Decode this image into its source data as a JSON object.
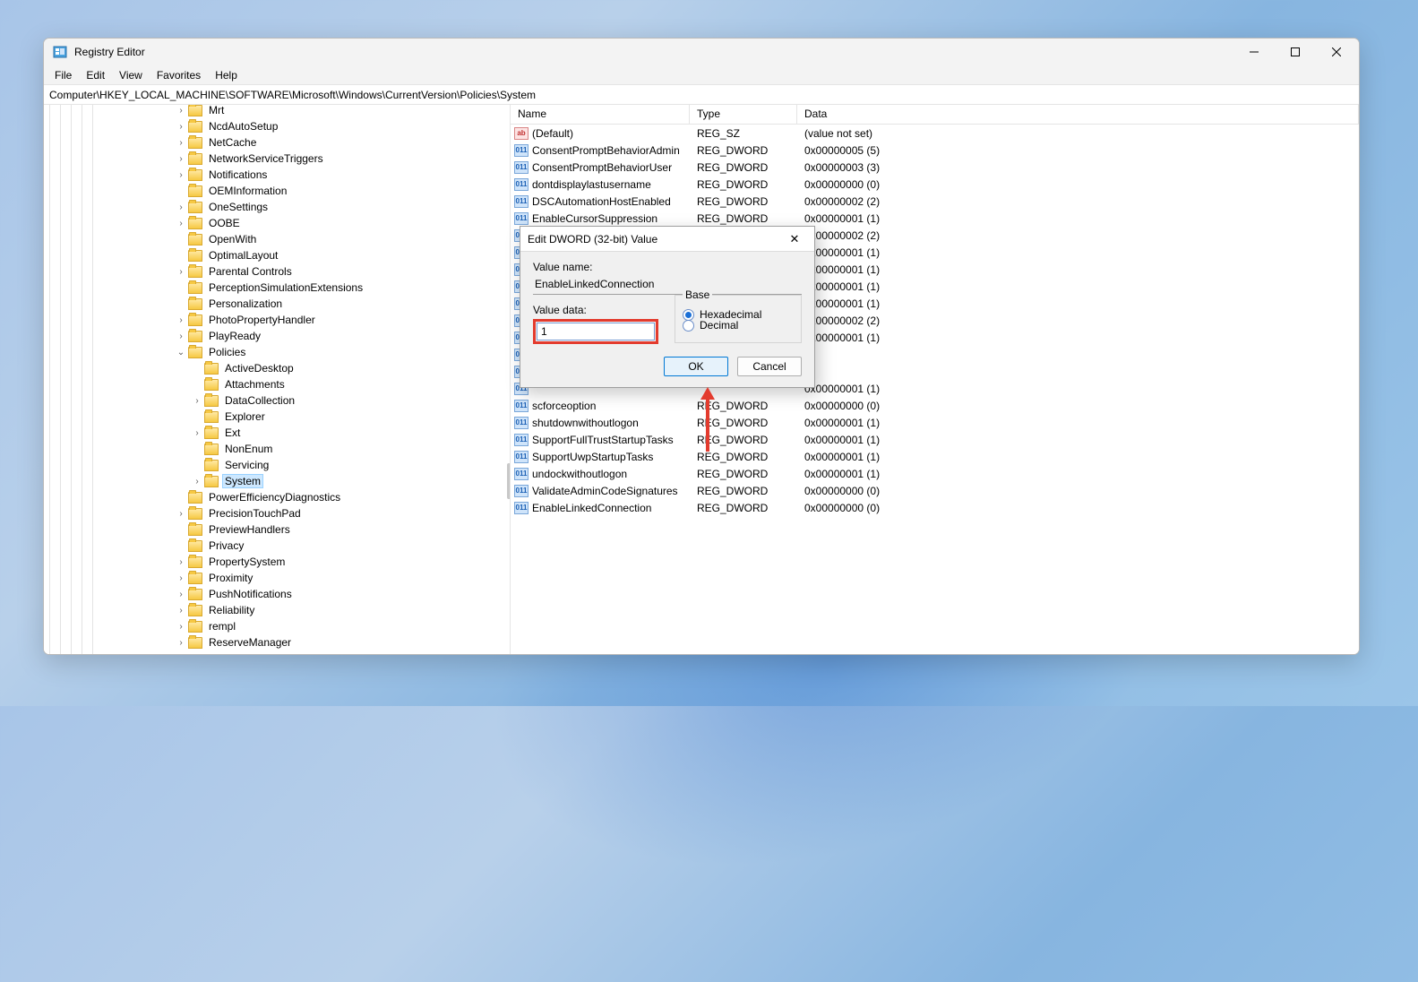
{
  "window": {
    "title": "Registry Editor",
    "menus": [
      "File",
      "Edit",
      "View",
      "Favorites",
      "Help"
    ],
    "address": "Computer\\HKEY_LOCAL_MACHINE\\SOFTWARE\\Microsoft\\Windows\\CurrentVersion\\Policies\\System"
  },
  "tree": [
    {
      "indent": 5,
      "expand": ">",
      "label": "Mrt"
    },
    {
      "indent": 5,
      "expand": ">",
      "label": "NcdAutoSetup"
    },
    {
      "indent": 5,
      "expand": ">",
      "label": "NetCache"
    },
    {
      "indent": 5,
      "expand": ">",
      "label": "NetworkServiceTriggers"
    },
    {
      "indent": 5,
      "expand": ">",
      "label": "Notifications"
    },
    {
      "indent": 5,
      "expand": "",
      "label": "OEMInformation"
    },
    {
      "indent": 5,
      "expand": ">",
      "label": "OneSettings"
    },
    {
      "indent": 5,
      "expand": ">",
      "label": "OOBE"
    },
    {
      "indent": 5,
      "expand": "",
      "label": "OpenWith"
    },
    {
      "indent": 5,
      "expand": "",
      "label": "OptimalLayout"
    },
    {
      "indent": 5,
      "expand": ">",
      "label": "Parental Controls"
    },
    {
      "indent": 5,
      "expand": "",
      "label": "PerceptionSimulationExtensions"
    },
    {
      "indent": 5,
      "expand": "",
      "label": "Personalization"
    },
    {
      "indent": 5,
      "expand": ">",
      "label": "PhotoPropertyHandler"
    },
    {
      "indent": 5,
      "expand": ">",
      "label": "PlayReady"
    },
    {
      "indent": 5,
      "expand": "v",
      "label": "Policies"
    },
    {
      "indent": 6,
      "expand": "",
      "label": "ActiveDesktop"
    },
    {
      "indent": 6,
      "expand": "",
      "label": "Attachments"
    },
    {
      "indent": 6,
      "expand": ">",
      "label": "DataCollection"
    },
    {
      "indent": 6,
      "expand": "",
      "label": "Explorer"
    },
    {
      "indent": 6,
      "expand": ">",
      "label": "Ext"
    },
    {
      "indent": 6,
      "expand": "",
      "label": "NonEnum"
    },
    {
      "indent": 6,
      "expand": "",
      "label": "Servicing"
    },
    {
      "indent": 6,
      "expand": ">",
      "label": "System",
      "selected": true
    },
    {
      "indent": 5,
      "expand": "",
      "label": "PowerEfficiencyDiagnostics"
    },
    {
      "indent": 5,
      "expand": ">",
      "label": "PrecisionTouchPad"
    },
    {
      "indent": 5,
      "expand": "",
      "label": "PreviewHandlers"
    },
    {
      "indent": 5,
      "expand": "",
      "label": "Privacy"
    },
    {
      "indent": 5,
      "expand": ">",
      "label": "PropertySystem"
    },
    {
      "indent": 5,
      "expand": ">",
      "label": "Proximity"
    },
    {
      "indent": 5,
      "expand": ">",
      "label": "PushNotifications"
    },
    {
      "indent": 5,
      "expand": ">",
      "label": "Reliability"
    },
    {
      "indent": 5,
      "expand": ">",
      "label": "rempl"
    },
    {
      "indent": 5,
      "expand": ">",
      "label": "ReserveManager"
    }
  ],
  "list": {
    "columns": {
      "name": "Name",
      "type": "Type",
      "data": "Data"
    },
    "rows": [
      {
        "icon": "sz",
        "name": "(Default)",
        "type": "REG_SZ",
        "data": "(value not set)"
      },
      {
        "icon": "dw",
        "name": "ConsentPromptBehaviorAdmin",
        "type": "REG_DWORD",
        "data": "0x00000005 (5)"
      },
      {
        "icon": "dw",
        "name": "ConsentPromptBehaviorUser",
        "type": "REG_DWORD",
        "data": "0x00000003 (3)"
      },
      {
        "icon": "dw",
        "name": "dontdisplaylastusername",
        "type": "REG_DWORD",
        "data": "0x00000000 (0)"
      },
      {
        "icon": "dw",
        "name": "DSCAutomationHostEnabled",
        "type": "REG_DWORD",
        "data": "0x00000002 (2)"
      },
      {
        "icon": "dw",
        "name": "EnableCursorSuppression",
        "type": "REG_DWORD",
        "data": "0x00000001 (1)"
      },
      {
        "icon": "dw",
        "name": "",
        "type": "",
        "data": "0x00000002 (2)"
      },
      {
        "icon": "dw",
        "name": "",
        "type": "",
        "data": "0x00000001 (1)"
      },
      {
        "icon": "dw",
        "name": "",
        "type": "",
        "data": "0x00000001 (1)"
      },
      {
        "icon": "dw",
        "name": "",
        "type": "",
        "data": "0x00000001 (1)"
      },
      {
        "icon": "dw",
        "name": "",
        "type": "",
        "data": "0x00000001 (1)"
      },
      {
        "icon": "dw",
        "name": "",
        "type": "",
        "data": "0x00000002 (2)"
      },
      {
        "icon": "dw",
        "name": "",
        "type": "",
        "data": "0x00000001 (1)"
      },
      {
        "icon": "dw",
        "name": "",
        "type": "",
        "data": ""
      },
      {
        "icon": "dw",
        "name": "",
        "type": "",
        "data": ""
      },
      {
        "icon": "dw",
        "name": "",
        "type": "",
        "data": "0x00000001 (1)"
      },
      {
        "icon": "dw",
        "name": "scforceoption",
        "type": "REG_DWORD",
        "data": "0x00000000 (0)"
      },
      {
        "icon": "dw",
        "name": "shutdownwithoutlogon",
        "type": "REG_DWORD",
        "data": "0x00000001 (1)"
      },
      {
        "icon": "dw",
        "name": "SupportFullTrustStartupTasks",
        "type": "REG_DWORD",
        "data": "0x00000001 (1)"
      },
      {
        "icon": "dw",
        "name": "SupportUwpStartupTasks",
        "type": "REG_DWORD",
        "data": "0x00000001 (1)"
      },
      {
        "icon": "dw",
        "name": "undockwithoutlogon",
        "type": "REG_DWORD",
        "data": "0x00000001 (1)"
      },
      {
        "icon": "dw",
        "name": "ValidateAdminCodeSignatures",
        "type": "REG_DWORD",
        "data": "0x00000000 (0)"
      },
      {
        "icon": "dw",
        "name": "EnableLinkedConnection",
        "type": "REG_DWORD",
        "data": "0x00000000 (0)"
      }
    ]
  },
  "dialog": {
    "title": "Edit DWORD (32-bit) Value",
    "value_name_label": "Value name:",
    "value_name": "EnableLinkedConnection",
    "value_data_label": "Value data:",
    "value_data": "1",
    "base_label": "Base",
    "hex_label": "Hexadecimal",
    "dec_label": "Decimal",
    "ok": "OK",
    "cancel": "Cancel"
  }
}
